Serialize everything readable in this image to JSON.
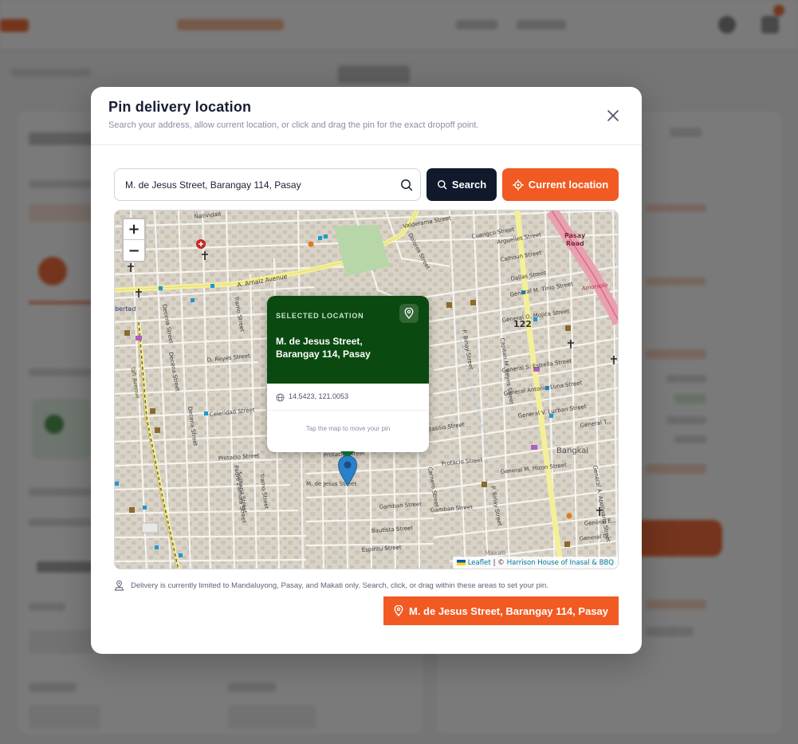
{
  "modal": {
    "title": "Pin delivery location",
    "subtitle": "Search your address, allow current location, or click and drag the pin for the exact dropoff point."
  },
  "search": {
    "value": "M. de Jesus Street, Barangay 114, Pasay",
    "search_label": "Search",
    "current_location_label": "Current location"
  },
  "map": {
    "zoom_in_label": "+",
    "zoom_out_label": "−",
    "popup": {
      "label": "SELECTED LOCATION",
      "address_line1": "M. de Jesus Street,",
      "address_line2": "Barangay 114, Pasay",
      "coords": "14.5423, 121.0053",
      "hint": "Tap the map to move your pin"
    },
    "attribution": {
      "leaflet": "Leaflet",
      "separator": "| ©",
      "credit": "Harrison House of Inasal & BBQ"
    },
    "labels": {
      "natividad": "Natividad",
      "valderama": "Valderama Street",
      "cuangco": "Cuangco Street",
      "arguelles": "Arguelles Street",
      "calhoun": "Calhoun Street",
      "dallas": "Dallas Street",
      "tinio": "General M. Tinio Street",
      "pasay_road_1": "Pasay",
      "pasay_road_2": "Road",
      "amorsolo": "Amorsolo",
      "arnaiz": "A. Arnaiz Avenue",
      "libertad": "bertad",
      "tramo": "Tramo Street",
      "decena": "Decena Street",
      "dreyes": "D. Reyes Street",
      "celeridad": "Celeridad Street",
      "taft": "Taft Avenue",
      "dimasalang": "Dimasalang",
      "ojosa": "General O. Mojica Street",
      "estrella": "General S. Estrella Street",
      "luna": "General Antonio Luna Street",
      "lucban": "General V. Lucban Street",
      "general_t": "General T...",
      "basilio": "Basilio Street",
      "protacio": "Protacio Street",
      "mdejesus": "M. de Jesus Street",
      "padrezamora": "Padre Zamora Street",
      "solitaria": "Solitaria Street",
      "tramo2": "Tramo Street",
      "gamban": "Gamban Street",
      "bautista": "Bautista Street",
      "espiritu": "Espiritu Street",
      "hizon": "General M. Hizon Street",
      "bangkal": "Bangkal",
      "makati": "Makati",
      "pbinay": "P. Binay Street",
      "capitan": "Capitan M. Reyes Street",
      "general_e": "General E...",
      "general_g": "General G...",
      "apolinario": "General A. Apolinario Street",
      "dolores": "Dolores Street",
      "carnero": "Carnero Street",
      "pbinay2": "P. Binay Street",
      "number_122": "122",
      "onto": "Onto Street"
    }
  },
  "notice": "Delivery is currently limited to Mandaluyong, Pasay, and Makati only. Search, click, or drag within these areas to set your pin.",
  "confirm_label": "M. de Jesus Street, Barangay 114, Pasay",
  "colors": {
    "accent": "#f15a22",
    "dark": "#101a2c",
    "popup_green": "#0a4a10",
    "marker_blue": "#2a81cb"
  }
}
